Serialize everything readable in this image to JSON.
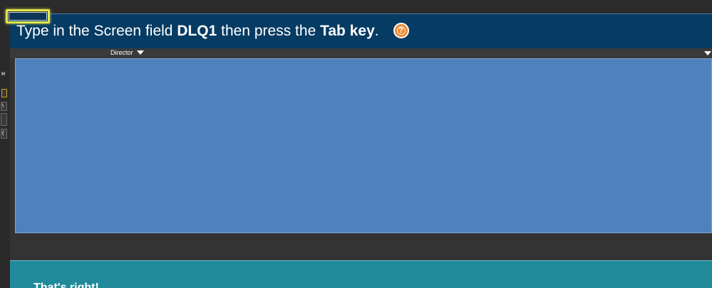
{
  "instruction": {
    "prefix": "Type in the Screen field ",
    "field_value": "DLQ1",
    "middle": " then press the ",
    "key_name": "Tab key",
    "suffix": "."
  },
  "header": {
    "director_label": "Director"
  },
  "sidebar": {
    "marks": [
      "H",
      "\\",
      "("
    ]
  },
  "feedback": {
    "message": "That's right!"
  },
  "icons": {
    "help": "help-icon",
    "dropdown": "chevron-down-icon"
  },
  "colors": {
    "instruction_bg": "#063b63",
    "highlight": "#e5e84a",
    "overlay_blue": "#4f81bd",
    "feedback_bg": "#218a9a",
    "help_orange": "#f0862c"
  }
}
